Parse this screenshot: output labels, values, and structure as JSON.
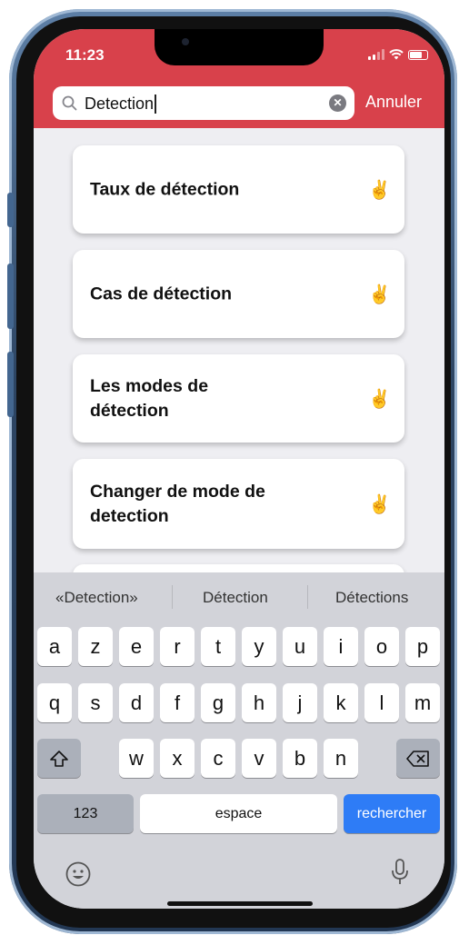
{
  "status_bar": {
    "time": "11:23"
  },
  "search": {
    "query": "Detection",
    "cancel_label": "Annuler"
  },
  "results": [
    {
      "title": "Taux de détection",
      "icon": "victory-hand-icon"
    },
    {
      "title": "Cas de détection",
      "icon": "victory-hand-icon"
    },
    {
      "title": "Les modes de détection",
      "icon": "victory-hand-icon"
    },
    {
      "title": "Changer de mode de detection",
      "icon": "victory-hand-icon"
    }
  ],
  "icons": {
    "result_hand": "✌️"
  },
  "keyboard": {
    "suggestions": [
      "«Detection»",
      "Détection",
      "Détections"
    ],
    "row1": [
      "a",
      "z",
      "e",
      "r",
      "t",
      "y",
      "u",
      "i",
      "o",
      "p"
    ],
    "row2": [
      "q",
      "s",
      "d",
      "f",
      "g",
      "h",
      "j",
      "k",
      "l",
      "m"
    ],
    "row3": [
      "w",
      "x",
      "c",
      "v",
      "b",
      "n"
    ],
    "numbers_label": "123",
    "space_label": "espace",
    "search_label": "rechercher"
  },
  "colors": {
    "header": "#d8414b",
    "search_key": "#2e7cf6",
    "keyboard_bg": "#d2d3d9"
  }
}
